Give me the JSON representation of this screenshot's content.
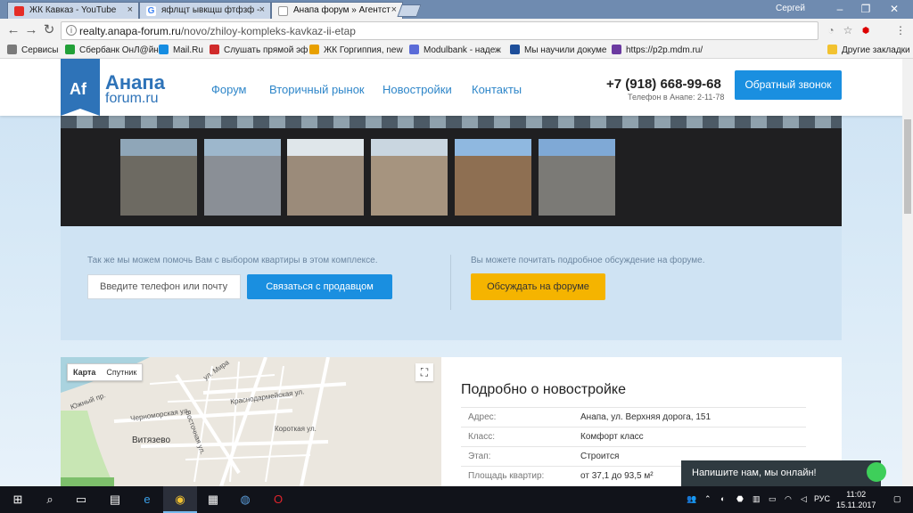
{
  "browser": {
    "tabs": [
      {
        "title": "ЖК Кавказ - YouTube",
        "icon": "youtube-icon",
        "color": "#e52d27"
      },
      {
        "title": "яфлщт ывкщш фтфзф - ",
        "icon": "google-icon",
        "color": "#4285f4"
      },
      {
        "title": "Анапа форум » Агентст",
        "icon": "page-icon",
        "color": "#dddddd"
      }
    ],
    "user": "Сергей",
    "url_host": "realty.anapa-forum.ru",
    "url_path": "/novo/zhiloy-kompleks-kavkaz-ii-etap",
    "bookmarks": [
      {
        "label": "Сервисы",
        "color": "#7a7a7a"
      },
      {
        "label": "Сбербанк ОнЛ@йн",
        "color": "#21a038"
      },
      {
        "label": "Mail.Ru",
        "color": "#168de2"
      },
      {
        "label": "Слушать прямой эф",
        "color": "#d02b2b"
      },
      {
        "label": "ЖК Горгиппия, new",
        "color": "#e8a000"
      },
      {
        "label": "Modulbank - надеж",
        "color": "#5b6cd8"
      },
      {
        "label": "Мы научили докуме",
        "color": "#1d4e9a"
      },
      {
        "label": "https://p2p.mdm.ru/",
        "color": "#6b3aa0"
      }
    ],
    "other_bookmarks": "Другие закладки"
  },
  "site": {
    "logo_mark": "Af",
    "logo_title": "Анапа",
    "logo_sub": "forum.ru",
    "nav": [
      "Форум",
      "Вторичный рынок",
      "Новостройки",
      "Контакты"
    ],
    "phone": "+7 (918) 668-99-68",
    "phone_note": "Телефон в Анапе: 2-11-78",
    "callback_button": "Обратный звонок"
  },
  "gallery": {
    "thumbs": [
      {
        "sky": "#8fa6b8",
        "body": "#6d6a62"
      },
      {
        "sky": "#9db7cc",
        "body": "#8a8f96"
      },
      {
        "sky": "#dfe6ea",
        "body": "#9b8b7a"
      },
      {
        "sky": "#c9d6e0",
        "body": "#a6947f"
      },
      {
        "sky": "#8fb8e0",
        "body": "#8e6f52"
      },
      {
        "sky": "#7fa9d6",
        "body": "#7b7a76"
      }
    ]
  },
  "cta": {
    "left_text": "Так же мы можем помочь Вам с выбором квартиры в этом комплексе.",
    "input_placeholder": "Введите телефон или почту",
    "contact_button": "Связаться с продавцом",
    "right_text": "Вы можете почитать подробное обсуждение на форуме.",
    "forum_button": "Обсуждать на форуме"
  },
  "map": {
    "tab_map": "Карта",
    "tab_satellite": "Спутник",
    "labels": [
      "Черноморская ул.",
      "Краснодармейская ул.",
      "Витязево",
      "Короткая ул.",
      "Восточная ул.",
      "ул. Мира",
      "Южный пр."
    ]
  },
  "details": {
    "title": "Подробно о новостройке",
    "rows": [
      {
        "key": "Адрес:",
        "value": "Анапа, ул. Верхняя дорога, 151"
      },
      {
        "key": "Класс:",
        "value": "Комфорт класс"
      },
      {
        "key": "Этап:",
        "value": "Строится"
      },
      {
        "key": "Площадь квартир:",
        "value": "от 37,1 до 93,5 м²"
      }
    ]
  },
  "chat": {
    "label": "Напишите нам, мы онлайн!"
  },
  "taskbar": {
    "lang": "РУС",
    "time": "11:02",
    "date": "15.11.2017"
  }
}
